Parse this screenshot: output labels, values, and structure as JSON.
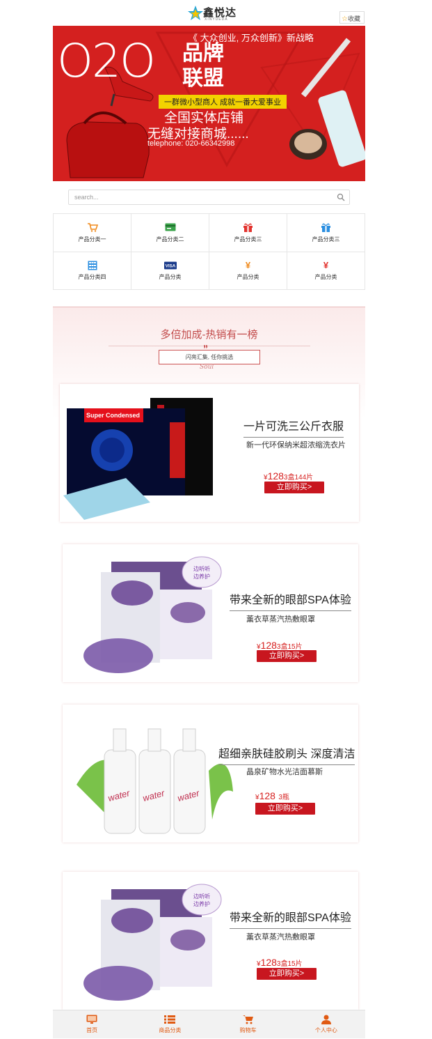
{
  "header": {
    "logo_text": "鑫悦达",
    "logo_sub": "XINYUEDA",
    "favorite_label": "收藏"
  },
  "banner": {
    "o2o": "O2O",
    "tagline": "《 大众创业, 万众创新》新战略",
    "brand_line1": "品牌",
    "brand_line2": "联盟",
    "slogan": "一群微小型商人 成就一番大爱事业",
    "line1": "全国实体店铺",
    "line2": "无缝对接商城......",
    "telephone": "telephone: 020-66342998"
  },
  "search": {
    "placeholder": "search..."
  },
  "categories": [
    {
      "label": "产品分类一",
      "icon": "cart-icon",
      "color": "#f08a1c"
    },
    {
      "label": "产品分类二",
      "icon": "card-icon",
      "color": "#3aa34a"
    },
    {
      "label": "产品分类三",
      "icon": "gift-icon",
      "color": "#e2332e"
    },
    {
      "label": "产品分类三",
      "icon": "gift-icon",
      "color": "#2a8ee0"
    },
    {
      "label": "产品分类四",
      "icon": "calculator-icon",
      "color": "#2a8ee0"
    },
    {
      "label": "产品分类",
      "icon": "visa-icon",
      "color": "#1a3a8a"
    },
    {
      "label": "产品分类",
      "icon": "yen-icon",
      "color": "#f08a1c"
    },
    {
      "label": "产品分类",
      "icon": "yen-icon",
      "color": "#e2332e"
    }
  ],
  "section": {
    "title": "多倍加成-热销有一榜",
    "quote_mark": "”",
    "subtitle": "闪亮汇集, 任你挑选",
    "signature": "Soul"
  },
  "products": [
    {
      "title": "一片可洗三公斤衣服",
      "subtitle": "新一代环保纳米超浓缩洗衣片",
      "currency": "¥",
      "price": "128",
      "qty": "3盒144片",
      "button": "立即购买>",
      "package_text": "Super Condensed"
    },
    {
      "title": "带来全新的眼部SPA体验",
      "subtitle": "薰衣草蒸汽热敷眼罩",
      "currency": "¥",
      "price": "128",
      "qty": "3盒15片",
      "button": "立即购买>"
    },
    {
      "title": "超细亲肤硅胶刷头 深度清洁",
      "subtitle": "晶泉矿物水光洁面慕斯",
      "currency": "¥",
      "price": "128",
      "qty": "3瓶",
      "button": "立即购买>",
      "bottle_text": "water"
    },
    {
      "title": "带来全新的眼部SPA体验",
      "subtitle": "薰衣草蒸汽热敷眼罩",
      "currency": "¥",
      "price": "128",
      "qty": "3盒15片",
      "button": "立即购买>"
    }
  ],
  "nav": [
    {
      "label": "首页",
      "icon": "monitor-icon"
    },
    {
      "label": "商品分类",
      "icon": "list-icon"
    },
    {
      "label": "购物车",
      "icon": "cart-icon"
    },
    {
      "label": "个人中心",
      "icon": "user-icon"
    }
  ],
  "colors": {
    "accent": "#d4201f",
    "nav_text": "#e05a12",
    "button": "#c8161f"
  }
}
